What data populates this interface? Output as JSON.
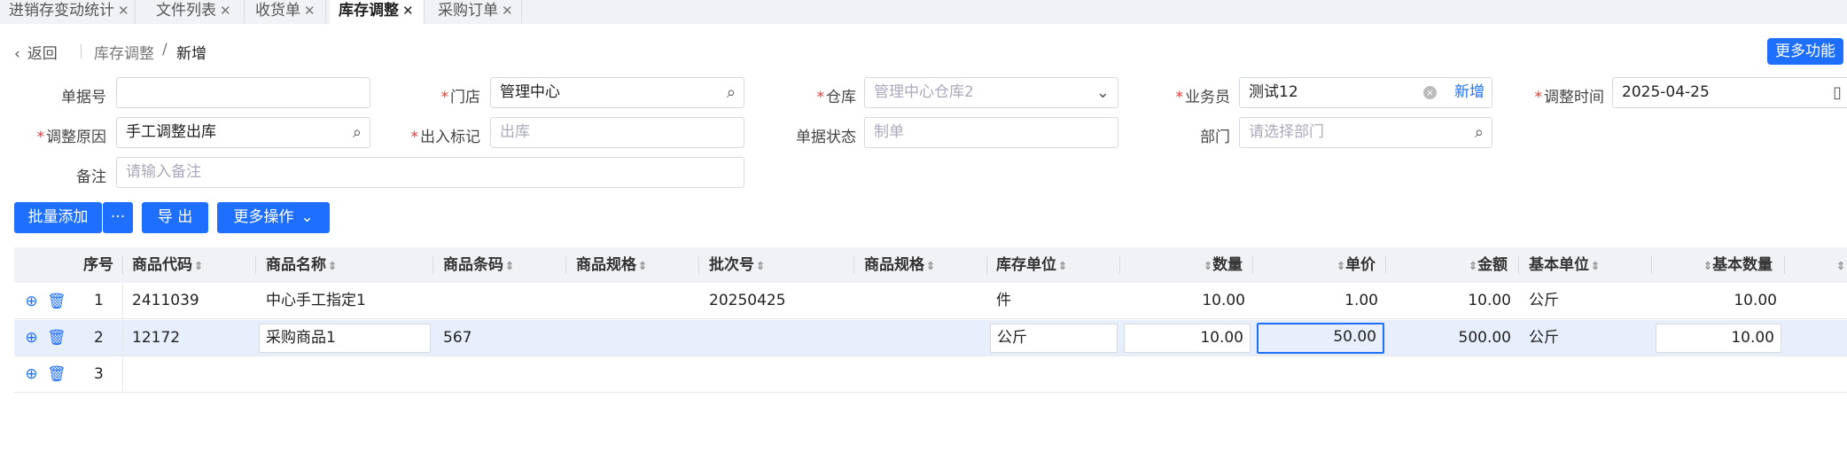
{
  "tabs": [
    {
      "label": "进销存变动统计",
      "close": "✕"
    },
    {
      "label": "文件列表",
      "close": "✕"
    },
    {
      "label": "收货单",
      "close": "✕"
    },
    {
      "label": "库存调整",
      "close": "✕"
    },
    {
      "label": "采购订单",
      "close": "✕"
    }
  ],
  "header": {
    "back_label": "返回",
    "breadcrumb_parent": "库存调整",
    "breadcrumb_sep": "/",
    "breadcrumb_current": "新增",
    "more_functions": "更多功能"
  },
  "form": {
    "doc_no": {
      "label": "单据号",
      "value": ""
    },
    "store": {
      "label": "门店",
      "value": "管理中心"
    },
    "warehouse": {
      "label": "仓库",
      "placeholder": "管理中心仓库2"
    },
    "salesman": {
      "label": "业务员",
      "value": "测试12",
      "new_label": "新增"
    },
    "adjust_time": {
      "label": "调整时间",
      "value": "2025-04-25"
    },
    "reason": {
      "label": "调整原因",
      "value": "手工调整出库"
    },
    "inout_flag": {
      "label": "出入标记",
      "placeholder": "出库"
    },
    "doc_status": {
      "label": "单据状态",
      "placeholder": "制单"
    },
    "department": {
      "label": "部门",
      "placeholder": "请选择部门"
    },
    "remark": {
      "label": "备注",
      "placeholder": "请输入备注"
    }
  },
  "toolbar": {
    "batch_add": "批量添加",
    "batch_more": "···",
    "export": "导 出",
    "more_ops": "更多操作"
  },
  "table": {
    "columns": [
      "序号",
      "商品代码",
      "商品名称",
      "商品条码",
      "商品规格",
      "批次号",
      "商品规格",
      "库存单位",
      "数量",
      "单价",
      "金额",
      "基本单位",
      "基本数量"
    ],
    "rows": [
      {
        "no": "1",
        "code": "2411039",
        "name": "中心手工指定1",
        "barcode": "",
        "batch": "20250425",
        "unit": "件",
        "qty": "10.00",
        "price": "1.00",
        "amount": "10.00",
        "base_unit": "公斤",
        "base_qty": "10.00"
      },
      {
        "no": "2",
        "code": "12172",
        "name": "采购商品1",
        "barcode": "567",
        "batch": "",
        "unit": "公斤",
        "qty": "10.00",
        "price": "50.00",
        "amount": "500.00",
        "base_unit": "公斤",
        "base_qty": "10.00"
      },
      {
        "no": "3"
      }
    ]
  },
  "colors": {
    "primary": "#1f6fff",
    "required": "#e53935",
    "selected_row": "#e7eefc"
  }
}
